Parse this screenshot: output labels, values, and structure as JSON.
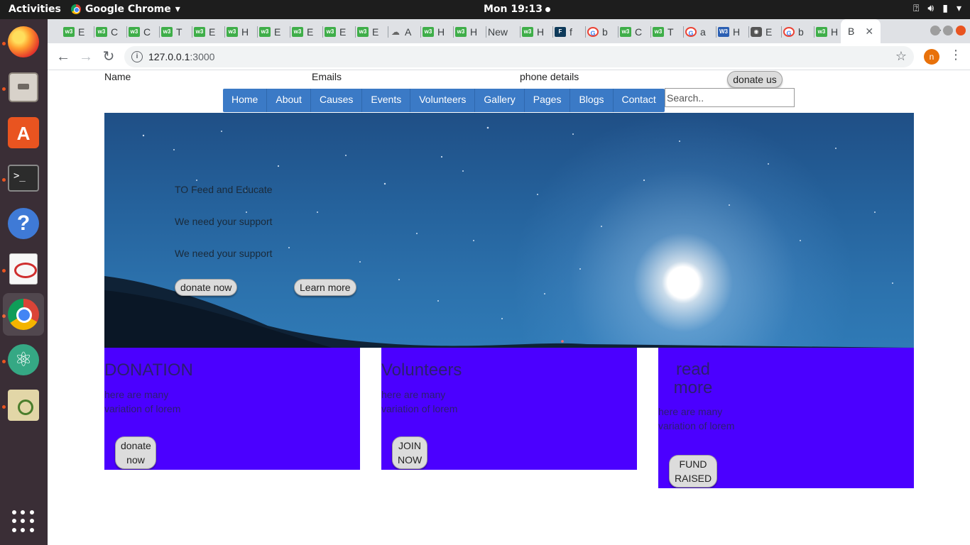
{
  "os": {
    "activities": "Activities",
    "app_name": "Google Chrome",
    "clock": "Mon 19:13"
  },
  "browser": {
    "tabs": [
      {
        "icon": "w3schools-icon",
        "title": "E"
      },
      {
        "icon": "w3schools-icon",
        "title": "C"
      },
      {
        "icon": "w3schools-icon",
        "title": "C"
      },
      {
        "icon": "w3schools-icon",
        "title": "T"
      },
      {
        "icon": "w3schools-icon",
        "title": "E"
      },
      {
        "icon": "w3schools-icon",
        "title": "H"
      },
      {
        "icon": "w3schools-icon",
        "title": "E"
      },
      {
        "icon": "w3schools-icon",
        "title": "E"
      },
      {
        "icon": "w3schools-icon",
        "title": "E"
      },
      {
        "icon": "w3schools-icon",
        "title": "E"
      },
      {
        "icon": "cloud-icon",
        "title": "A"
      },
      {
        "icon": "w3schools-icon",
        "title": "H"
      },
      {
        "icon": "w3schools-icon",
        "title": "H"
      },
      {
        "icon": "none",
        "title": "New"
      },
      {
        "icon": "w3schools-icon",
        "title": "H"
      },
      {
        "icon": "f-icon",
        "title": "f"
      },
      {
        "icon": "google-icon",
        "title": "b"
      },
      {
        "icon": "w3schools-icon",
        "title": "C"
      },
      {
        "icon": "w3schools-icon",
        "title": "T"
      },
      {
        "icon": "google-icon",
        "title": "a"
      },
      {
        "icon": "w3c-icon",
        "title": "H"
      },
      {
        "icon": "camera-icon",
        "title": "E"
      },
      {
        "icon": "google-icon",
        "title": "b"
      },
      {
        "icon": "w3schools-icon",
        "title": "H"
      }
    ],
    "active_tab": {
      "title": "B"
    },
    "url_host": "127.0.0.1",
    "url_port": ":3000",
    "profile_initial": "n"
  },
  "site": {
    "header": {
      "name": "Name",
      "emails": "Emails",
      "phone": "phone details",
      "donate_button": "donate us"
    },
    "nav": [
      "Home",
      "About",
      "Causes",
      "Events",
      "Volunteers",
      "Gallery",
      "Pages",
      "Blogs",
      "Contact"
    ],
    "search_placeholder": "Search..",
    "hero": {
      "line1": "TO Feed and Educate",
      "line2": "We need your support",
      "line3": "We need your support",
      "donate_button": "donate now",
      "learn_button": "Learn more"
    },
    "cards": [
      {
        "title": "DONATION",
        "text": "here are many variation of lorem",
        "button": "donate now"
      },
      {
        "title": "Volunteers",
        "text": "here are many variation of lorem",
        "button": "JOIN NOW"
      },
      {
        "title": "read more",
        "text": "here are many variation of lorem",
        "button": "FUND RAISED"
      }
    ]
  },
  "colors": {
    "card_bg": "#4b00ff",
    "nav_bg": "#3b7ac6",
    "os_accent": "#e95420"
  }
}
